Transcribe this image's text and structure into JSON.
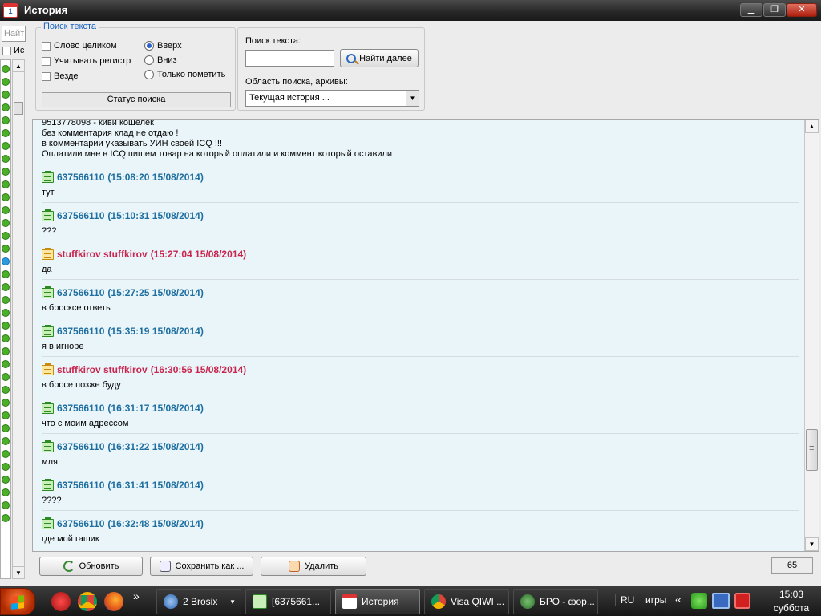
{
  "window": {
    "title": "История",
    "buttons": {
      "minimize": "▁",
      "restore": "❐",
      "close": "✕"
    }
  },
  "left": {
    "search_placeholder": "Найт",
    "checkbox_label": "Ис"
  },
  "search_options": {
    "legend": "Поиск текста",
    "checkboxes": [
      "Слово целиком",
      "Учитывать регистр",
      "Везде"
    ],
    "radios": [
      "Вверх",
      "Вниз",
      "Только пометить"
    ],
    "selected_radio": "Вверх",
    "status_button": "Статус поиска"
  },
  "search_text": {
    "label": "Поиск текста:",
    "value": "",
    "find_next": "Найти далее",
    "area_label": "Область поиска, архивы:",
    "area_value": "Текущая история ..."
  },
  "history": {
    "preceding_lines": [
      "9513778098 - киви кошелек",
      "без комментария клад не отдаю !",
      "в комментарии указывать УИН своей ICQ !!!",
      "Оплатили мне в ICQ пишем товар на который оплатили и коммент который оставили"
    ],
    "messages": [
      {
        "sender": "637566110",
        "time": "(15:08:20 15/08/2014)",
        "text": "тут",
        "incoming": true
      },
      {
        "sender": "637566110",
        "time": "(15:10:31 15/08/2014)",
        "text": "???",
        "incoming": true
      },
      {
        "sender": "stuffkirov stuffkirov",
        "time": "(15:27:04 15/08/2014)",
        "text": "да",
        "incoming": false
      },
      {
        "sender": "637566110",
        "time": "(15:27:25 15/08/2014)",
        "text": "в броcксе ответь",
        "incoming": true
      },
      {
        "sender": "637566110",
        "time": "(15:35:19 15/08/2014)",
        "text": "я в игноре",
        "incoming": true
      },
      {
        "sender": "stuffkirov stuffkirov",
        "time": "(16:30:56 15/08/2014)",
        "text": "в бросе позже буду",
        "incoming": false
      },
      {
        "sender": "637566110",
        "time": "(16:31:17 15/08/2014)",
        "text": "что с моим адрессом",
        "incoming": true
      },
      {
        "sender": "637566110",
        "time": "(16:31:22 15/08/2014)",
        "text": "мля",
        "incoming": true
      },
      {
        "sender": "637566110",
        "time": "(16:31:41 15/08/2014)",
        "text": "????",
        "incoming": true
      },
      {
        "sender": "637566110",
        "time": "(16:32:48 15/08/2014)",
        "text": "где мой гашик",
        "incoming": true
      }
    ]
  },
  "bottom": {
    "refresh": "Обновить",
    "save_as": "Сохранить как ...",
    "delete": "Удалить",
    "count": "65"
  },
  "taskbar": {
    "more": "»",
    "tasks": [
      {
        "label": "2 Brosix",
        "icon": "brosix-icon"
      },
      {
        "label": "[6375661...",
        "icon": "icq-message-icon"
      },
      {
        "label": "История",
        "icon": "history-icon"
      },
      {
        "label": "Visa QIWI ...",
        "icon": "chrome-icon"
      },
      {
        "label": "БРО - фор...",
        "icon": "forum-icon"
      }
    ],
    "language": "RU",
    "toolbar_label": "игры",
    "tray_more": "«",
    "time": "15:03",
    "day": "суббота"
  },
  "colors": {
    "incoming": "#1e6fa0",
    "outgoing": "#c8244c",
    "history_bg": "#eaf5fa"
  }
}
